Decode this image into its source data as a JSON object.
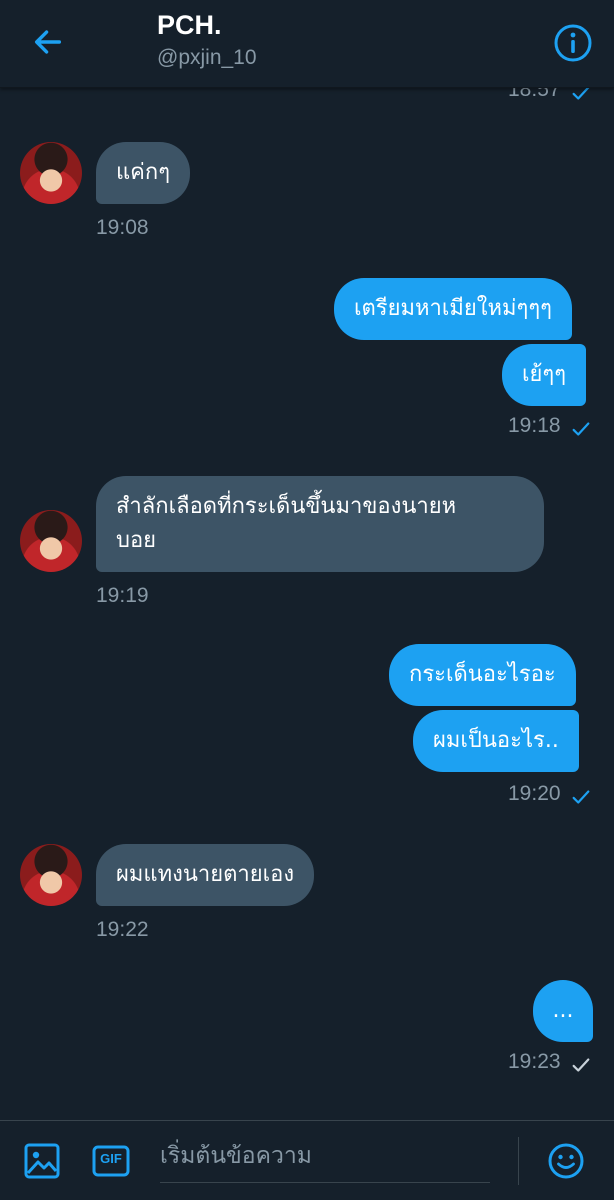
{
  "header": {
    "name": "PCH.",
    "handle": "@pxjin_10"
  },
  "messages": [
    {
      "dir": "out",
      "time": "18:57",
      "status": "read"
    },
    {
      "dir": "in",
      "texts": [
        "แค่กๆ"
      ],
      "time": "19:08"
    },
    {
      "dir": "out",
      "texts": [
        "เตรียมหาเมียใหม่ๆๆๆ",
        "เย้ๆๆ"
      ],
      "time": "19:18",
      "status": "read"
    },
    {
      "dir": "in",
      "texts": [
        "สำลักเลือดที่กระเด็นขึ้นมาของนายห\nบอย"
      ],
      "time": "19:19"
    },
    {
      "dir": "out",
      "texts": [
        "กระเด็นอะไรอะ",
        "ผมเป็นอะไร.."
      ],
      "time": "19:20",
      "status": "read"
    },
    {
      "dir": "in",
      "texts": [
        "ผมแทงนายตายเอง"
      ],
      "time": "19:22"
    },
    {
      "dir": "out",
      "texts": [
        "..."
      ],
      "time": "19:23",
      "status": "sent"
    }
  ],
  "composer": {
    "placeholder": "เริ่มต้นข้อความ",
    "gif_label": "GIF"
  },
  "colors": {
    "background": "#15202b",
    "incoming_bubble": "#3d5466",
    "outgoing_bubble": "#1da1f2",
    "accent": "#1da1f2",
    "muted_text": "#8899a6"
  },
  "icons": [
    "back-arrow-icon",
    "info-icon",
    "checkmark-icon",
    "image-icon",
    "gif-icon",
    "emoji-icon"
  ]
}
